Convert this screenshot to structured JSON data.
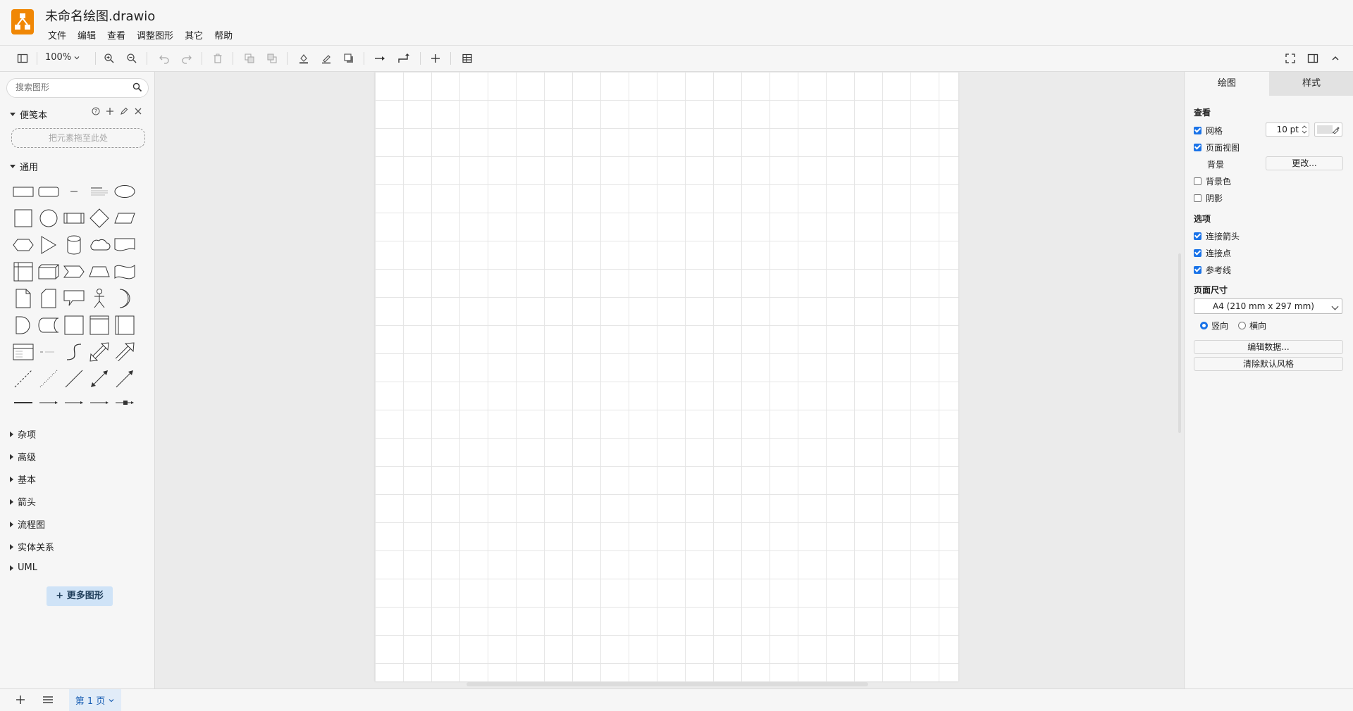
{
  "app": {
    "title": "未命名绘图.drawio"
  },
  "menu": [
    "文件",
    "编辑",
    "查看",
    "调整图形",
    "其它",
    "帮助"
  ],
  "toolbar": {
    "zoom": "100%"
  },
  "sidebar": {
    "search_placeholder": "搜索图形",
    "scratchpad": {
      "title": "便笺本",
      "drop_hint": "把元素拖至此处"
    },
    "general": {
      "title": "通用"
    },
    "collapsed_sections": [
      "杂项",
      "高级",
      "基本",
      "箭头",
      "流程图",
      "实体关系",
      "UML"
    ],
    "more_shapes_label": "更多图形",
    "more_shapes_plus": "+"
  },
  "format_panel": {
    "tabs": {
      "diagram": "绘图",
      "style": "样式"
    },
    "view": {
      "title": "查看",
      "grid_label": "网格",
      "grid_checked": true,
      "grid_size": "10 pt",
      "page_view_label": "页面视图",
      "page_view_checked": true,
      "background_label": "背景",
      "change_button": "更改...",
      "background_color_label": "背景色",
      "background_color_checked": false,
      "shadow_label": "阴影",
      "shadow_checked": false
    },
    "options": {
      "title": "选项",
      "connection_arrows_label": "连接箭头",
      "connection_points_label": "连接点",
      "guides_label": "参考线"
    },
    "page_size": {
      "title": "页面尺寸",
      "selected": "A4 (210 mm x 297 mm)",
      "portrait_label": "竖向",
      "landscape_label": "横向",
      "orientation": "portrait"
    },
    "edit_data_button": "编辑数据...",
    "clear_style_button": "清除默认风格"
  },
  "footer": {
    "page_tab": "第 1 页"
  },
  "colors": {
    "accent": "#1a73e8",
    "logo": "#f08705",
    "page_tab_bg": "#e1ecf8",
    "more_shapes_bg": "#cfe3f7"
  }
}
